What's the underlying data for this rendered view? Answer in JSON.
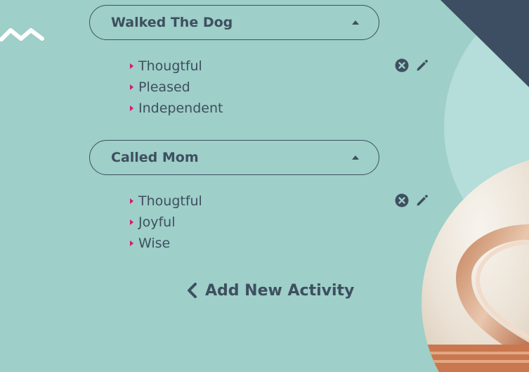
{
  "colors": {
    "background": "#9ecfc8",
    "text": "#3e4f60",
    "bullet": "#d8186e",
    "corner_accent": "#3d4e62",
    "circle_light": "#b5ddd9"
  },
  "decorations": {
    "wave": "zigzag-icon",
    "photo": "book-heart-photo"
  },
  "activities": [
    {
      "title": "Walked The Dog",
      "toggle_icon": "caret-up-icon",
      "emotions": [
        "Thougtful",
        "Pleased",
        "Independent"
      ],
      "actions": [
        "delete-icon",
        "edit-icon"
      ]
    },
    {
      "title": "Called Mom",
      "toggle_icon": "caret-up-icon",
      "emotions": [
        "Thougtful",
        "Joyful",
        "Wise"
      ],
      "actions": [
        "delete-icon",
        "edit-icon"
      ]
    }
  ],
  "add_activity": {
    "label": "Add New Activity",
    "icon": "chevron-left-icon"
  }
}
